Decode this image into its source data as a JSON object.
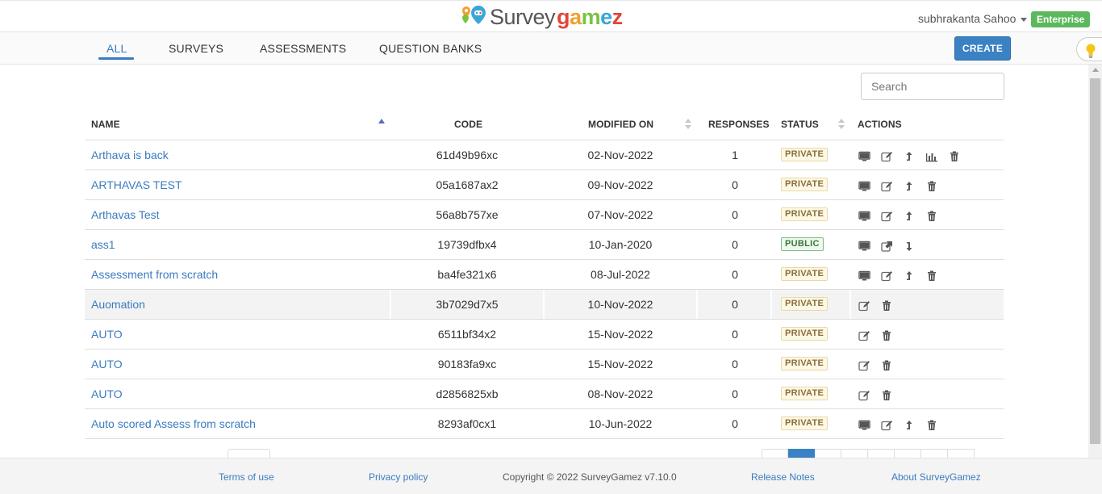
{
  "app": {
    "logo_text_1": "Survey",
    "logo_text_2": "gamez",
    "brand_colors": {
      "accent": "#3a7bbf",
      "button": "#3a82c4",
      "badge": "#5cb85c"
    }
  },
  "header": {
    "user_name": "subhrakanta Sahoo",
    "plan_badge": "Enterprise"
  },
  "tabs": [
    {
      "label": "ALL",
      "active": true
    },
    {
      "label": "SURVEYS",
      "active": false
    },
    {
      "label": "ASSESSMENTS",
      "active": false
    },
    {
      "label": "QUESTION BANKS",
      "active": false
    }
  ],
  "create_label": "CREATE",
  "search": {
    "placeholder": "Search",
    "value": ""
  },
  "table": {
    "headers": {
      "name": "NAME",
      "code": "CODE",
      "modified": "MODIFIED ON",
      "responses": "RESPONSES",
      "status": "STATUS",
      "actions": "ACTIONS"
    },
    "rows": [
      {
        "name": "Arthava is back",
        "code": "61d49b96xc",
        "modified": "02-Nov-2022",
        "responses": "1",
        "status": "PRIVATE",
        "actions": [
          "desktop-icon",
          "edit-icon",
          "publish-icon",
          "report-icon",
          "delete-icon"
        ]
      },
      {
        "name": "ARTHAVAS TEST",
        "code": "05a1687ax2",
        "modified": "09-Nov-2022",
        "responses": "0",
        "status": "PRIVATE",
        "actions": [
          "desktop-icon",
          "edit-icon",
          "publish-icon",
          "delete-icon"
        ]
      },
      {
        "name": "Arthavas Test",
        "code": "56a8b757xe",
        "modified": "07-Nov-2022",
        "responses": "0",
        "status": "PRIVATE",
        "actions": [
          "desktop-icon",
          "edit-icon",
          "publish-icon",
          "delete-icon"
        ]
      },
      {
        "name": "ass1",
        "code": "19739dfbx4",
        "modified": "10-Jan-2020",
        "responses": "0",
        "status": "PUBLIC",
        "actions": [
          "desktop-icon",
          "external-link-icon",
          "unpublish-icon"
        ]
      },
      {
        "name": "Assessment from scratch",
        "code": "ba4fe321x6",
        "modified": "08-Jul-2022",
        "responses": "0",
        "status": "PRIVATE",
        "actions": [
          "desktop-icon",
          "edit-icon",
          "publish-icon",
          "delete-icon"
        ]
      },
      {
        "name": "Auomation",
        "code": "3b7029d7x5",
        "modified": "10-Nov-2022",
        "responses": "0",
        "status": "PRIVATE",
        "actions": [
          "edit-icon",
          "delete-icon"
        ]
      },
      {
        "name": "AUTO",
        "code": "6511bf34x2",
        "modified": "15-Nov-2022",
        "responses": "0",
        "status": "PRIVATE",
        "actions": [
          "edit-icon",
          "delete-icon"
        ]
      },
      {
        "name": "AUTO",
        "code": "90183fa9xc",
        "modified": "15-Nov-2022",
        "responses": "0",
        "status": "PRIVATE",
        "actions": [
          "edit-icon",
          "delete-icon"
        ]
      },
      {
        "name": "AUTO",
        "code": "d2856825xb",
        "modified": "08-Nov-2022",
        "responses": "0",
        "status": "PRIVATE",
        "actions": [
          "edit-icon",
          "delete-icon"
        ]
      },
      {
        "name": "Auto scored Assess from scratch",
        "code": "8293af0cx1",
        "modified": "10-Jun-2022",
        "responses": "0",
        "status": "PRIVATE",
        "actions": [
          "desktop-icon",
          "edit-icon",
          "publish-icon",
          "delete-icon"
        ]
      }
    ],
    "highlighted_row": 5
  },
  "pagination": {
    "current_page": 1
  },
  "footer": {
    "terms": "Terms of use",
    "privacy": "Privacy policy",
    "copyright": "Copyright ©  2022 SurveyGamez v7.10.0",
    "release_notes": "Release Notes",
    "about": "About SurveyGamez"
  }
}
